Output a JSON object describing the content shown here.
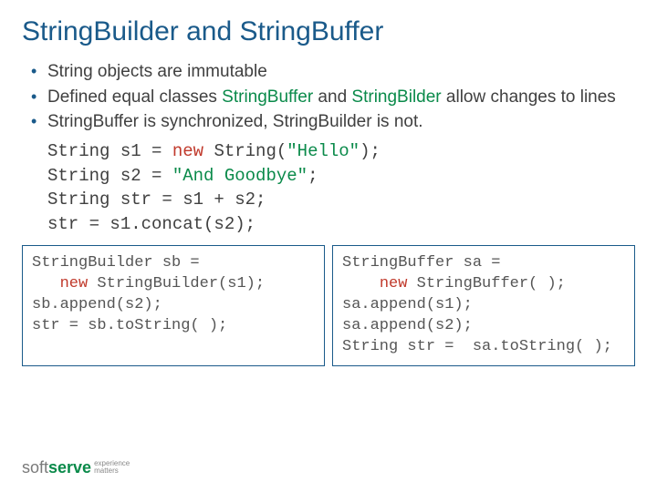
{
  "title": "StringBuilder and StringBuffer",
  "bullets": {
    "b1": "String objects are immutable",
    "b2_a": "Defined equal classes ",
    "b2_sb": "StringBuffer",
    "b2_mid": " and ",
    "b2_sbi": "StringBilder",
    "b2_b": " allow changes to lines",
    "b3": "StringBuffer is synchronized, StringBuilder is not."
  },
  "code": {
    "l1a": "String s1 = ",
    "l1new": "new",
    "l1b": " String(",
    "l1str": "\"Hello\"",
    "l1c": ");",
    "l2a": "String s2 = ",
    "l2str": "\"And Goodbye\"",
    "l2b": ";",
    "l3": "String str = s1 + s2;",
    "l4": "str = s1.concat(s2);"
  },
  "box1": {
    "l1": "StringBuilder sb =",
    "l2a": "   ",
    "l2new": "new",
    "l2b": " StringBuilder(s1);",
    "l3": "sb.append(s2);",
    "l4": "str = sb.toString( );"
  },
  "box2": {
    "l1": "StringBuffer sa =",
    "l2a": "    ",
    "l2new": "new",
    "l2b": " StringBuffer( );",
    "l3": "sa.append(s1);",
    "l4": "sa.append(s2);",
    "l5": "String str =  sa.toString( );"
  },
  "footer": {
    "soft": "soft",
    "serve": "serve",
    "tag1": "experience",
    "tag2": "matters"
  }
}
